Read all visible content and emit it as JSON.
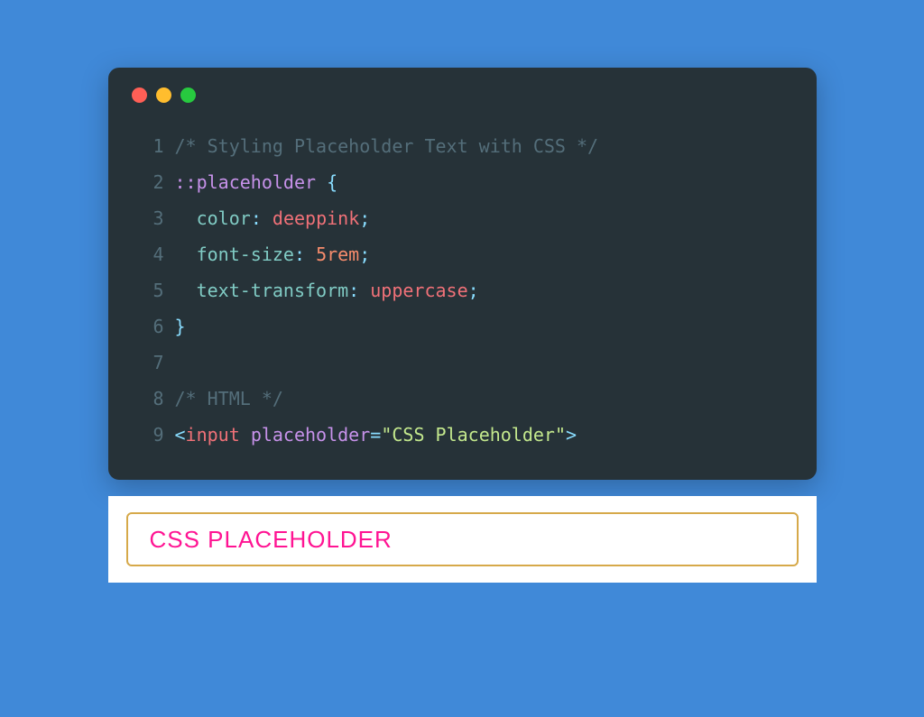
{
  "code": {
    "lines": [
      {
        "n": "1"
      },
      {
        "n": "2"
      },
      {
        "n": "3"
      },
      {
        "n": "4"
      },
      {
        "n": "5"
      },
      {
        "n": "6"
      },
      {
        "n": "7"
      },
      {
        "n": "8"
      },
      {
        "n": "9"
      }
    ],
    "l1_comment": "/* Styling Placeholder Text with CSS */",
    "l2_selector": "::placeholder",
    "l2_space": " ",
    "l2_brace": "{",
    "l3_indent": "  ",
    "l3_prop": "color",
    "l3_colon": ":",
    "l3_space": " ",
    "l3_val": "deeppink",
    "l3_semi": ";",
    "l4_indent": "  ",
    "l4_prop": "font-size",
    "l4_colon": ":",
    "l4_space": " ",
    "l4_val": "5rem",
    "l4_semi": ";",
    "l5_indent": "  ",
    "l5_prop": "text-transform",
    "l5_colon": ":",
    "l5_space": " ",
    "l5_val": "uppercase",
    "l5_semi": ";",
    "l6_brace": "}",
    "l8_comment": "/* HTML */",
    "l9_open": "<",
    "l9_tag": "input",
    "l9_space": " ",
    "l9_attr": "placeholder",
    "l9_eq": "=",
    "l9_q1": "\"",
    "l9_val": "CSS Placeholder",
    "l9_q2": "\"",
    "l9_close": ">"
  },
  "output": {
    "placeholder": "CSS Placeholder"
  }
}
